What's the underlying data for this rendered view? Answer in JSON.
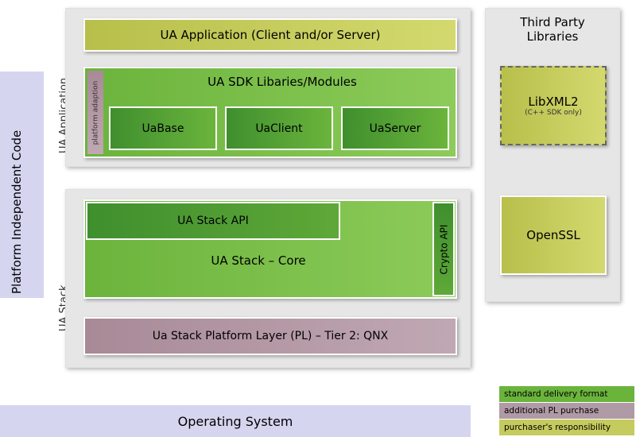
{
  "leftBand": {
    "label": "Platform Independent Code"
  },
  "sections": {
    "uaApp": {
      "sideLabel": "UA Application"
    },
    "uaStack": {
      "sideLabel": "UA Stack"
    }
  },
  "uaApplication": {
    "appBlock": "UA Application (Client and/or Server)",
    "sdk": {
      "title": "UA SDK Libaries/Modules",
      "platformAdaption": "platform adaption",
      "modules": [
        "UaBase",
        "UaClient",
        "UaServer"
      ]
    }
  },
  "uaStack": {
    "api": "UA Stack API",
    "core": "UA Stack – Core",
    "cryptoApi": "Crypto API",
    "platformLayer": "Ua Stack Platform Layer (PL) – Tier 2: QNX"
  },
  "thirdParty": {
    "title1": "Third Party",
    "title2": "Libraries",
    "libxml": {
      "name": "LibXML2",
      "note": "(C++ SDK only)"
    },
    "openssl": "OpenSSL"
  },
  "os": "Operating System",
  "legend": {
    "standard": "standard delivery format",
    "additional": "additional PL purchase",
    "purchaser": "purchaser's responsibility"
  }
}
